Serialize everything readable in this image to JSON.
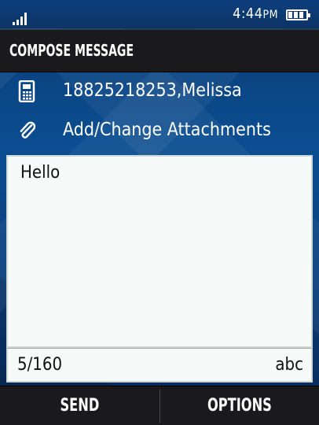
{
  "status_bar": {
    "time": "4:44",
    "ampm": "PM",
    "signal_icon": "signal-bars-icon",
    "battery_icon": "battery-icon"
  },
  "header": {
    "title": "COMPOSE MESSAGE"
  },
  "recipient": {
    "icon": "phone-icon",
    "text": "18825218253,Melissa"
  },
  "attachments": {
    "icon": "paperclip-icon",
    "label": "Add/Change Attachments"
  },
  "message": {
    "body": "Hello"
  },
  "counter": {
    "chars": "5/160",
    "input_mode": "abc"
  },
  "softkeys": {
    "left": "SEND",
    "right": "OPTIONS"
  },
  "colors": {
    "background": "#0b4e91",
    "bar": "#1a1a1c",
    "text_area": "#f6faf9"
  }
}
